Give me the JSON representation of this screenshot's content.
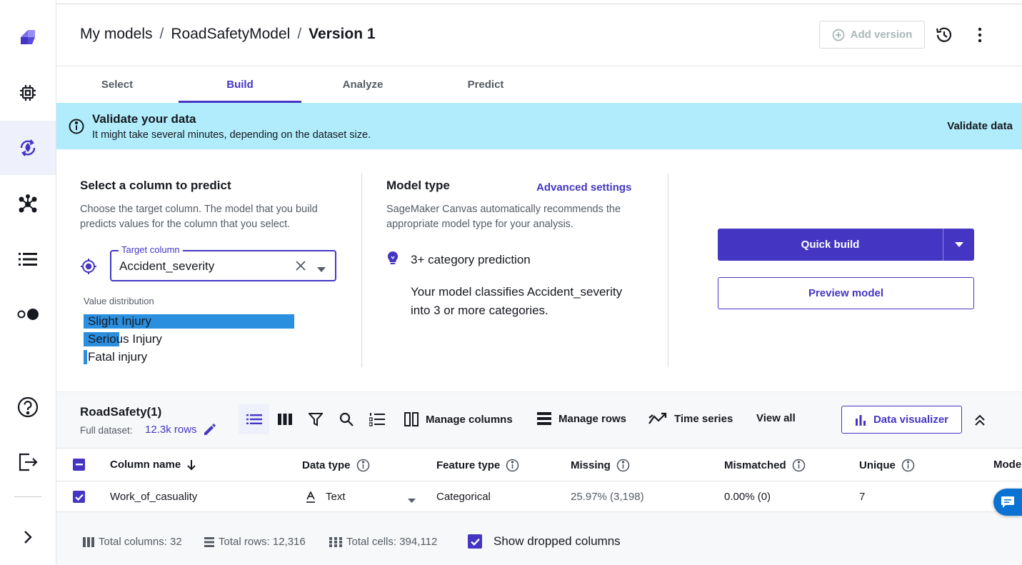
{
  "nav": {
    "items": [
      {
        "name": "canvas-logo-icon"
      },
      {
        "name": "chip-icon"
      },
      {
        "name": "model-refresh-icon",
        "active": true
      },
      {
        "name": "network-icon"
      },
      {
        "name": "list-icon"
      },
      {
        "name": "toggle-icon"
      }
    ],
    "bottom": [
      {
        "name": "help-icon"
      },
      {
        "name": "logout-icon"
      },
      {
        "name": "expand-icon"
      }
    ]
  },
  "header": {
    "breadcrumb": [
      "My models",
      "RoadSafetyModel",
      "Version 1"
    ],
    "separator": "/",
    "add_version": "Add version"
  },
  "tabs": [
    {
      "label": "Select",
      "active": false
    },
    {
      "label": "Build",
      "active": true
    },
    {
      "label": "Analyze",
      "active": false
    },
    {
      "label": "Predict",
      "active": false
    }
  ],
  "banner": {
    "title": "Validate your data",
    "text": "It might take several minutes, depending on the dataset size.",
    "action": "Validate data",
    "color": "#b0ecfb"
  },
  "predict": {
    "title": "Select a column to predict",
    "desc_line1": "Choose the target column. The model that you build",
    "desc_line2": "predicts values for the column that you select.",
    "target_label": "Target column",
    "target_value": "Accident_severity",
    "distribution_label": "Value distribution",
    "distribution": [
      {
        "label": "Slight Injury",
        "fraction": 1.0
      },
      {
        "label": "Serious Injury",
        "fraction": 0.17
      },
      {
        "label": "Fatal injury",
        "fraction": 0.017
      }
    ]
  },
  "model_type": {
    "title": "Model type",
    "advanced": "Advanced settings",
    "desc_line1": "SageMaker Canvas automatically recommends the",
    "desc_line2": "appropriate model type for your analysis.",
    "name": "3+ category prediction",
    "explain_line1": "Your model classifies Accident_severity",
    "explain_line2": "into 3 or more categories."
  },
  "build": {
    "quick_build": "Quick build",
    "preview": "Preview model",
    "accent": "#4436c2"
  },
  "dataset": {
    "name": "RoadSafety(1)",
    "full_label": "Full dataset:",
    "rows_link": "12.3k rows",
    "toolbar": {
      "manage_columns": "Manage columns",
      "manage_rows": "Manage rows",
      "time_series": "Time series",
      "view_all": "View all",
      "data_visualizer": "Data visualizer"
    },
    "columns": [
      "Column name",
      "Data type",
      "Feature type",
      "Missing",
      "Mismatched",
      "Unique",
      "Mode"
    ],
    "rows": [
      {
        "name": "Work_of_casuality",
        "data_type": "Text",
        "feature_type": "Categorical",
        "missing": "25.97% (3,198)",
        "mismatched": "0.00% (0)",
        "unique": "7"
      }
    ]
  },
  "footer": {
    "total_columns": "Total columns: 32",
    "total_rows": "Total rows: 12,316",
    "total_cells": "Total cells: 394,112",
    "show_dropped": "Show dropped columns"
  }
}
